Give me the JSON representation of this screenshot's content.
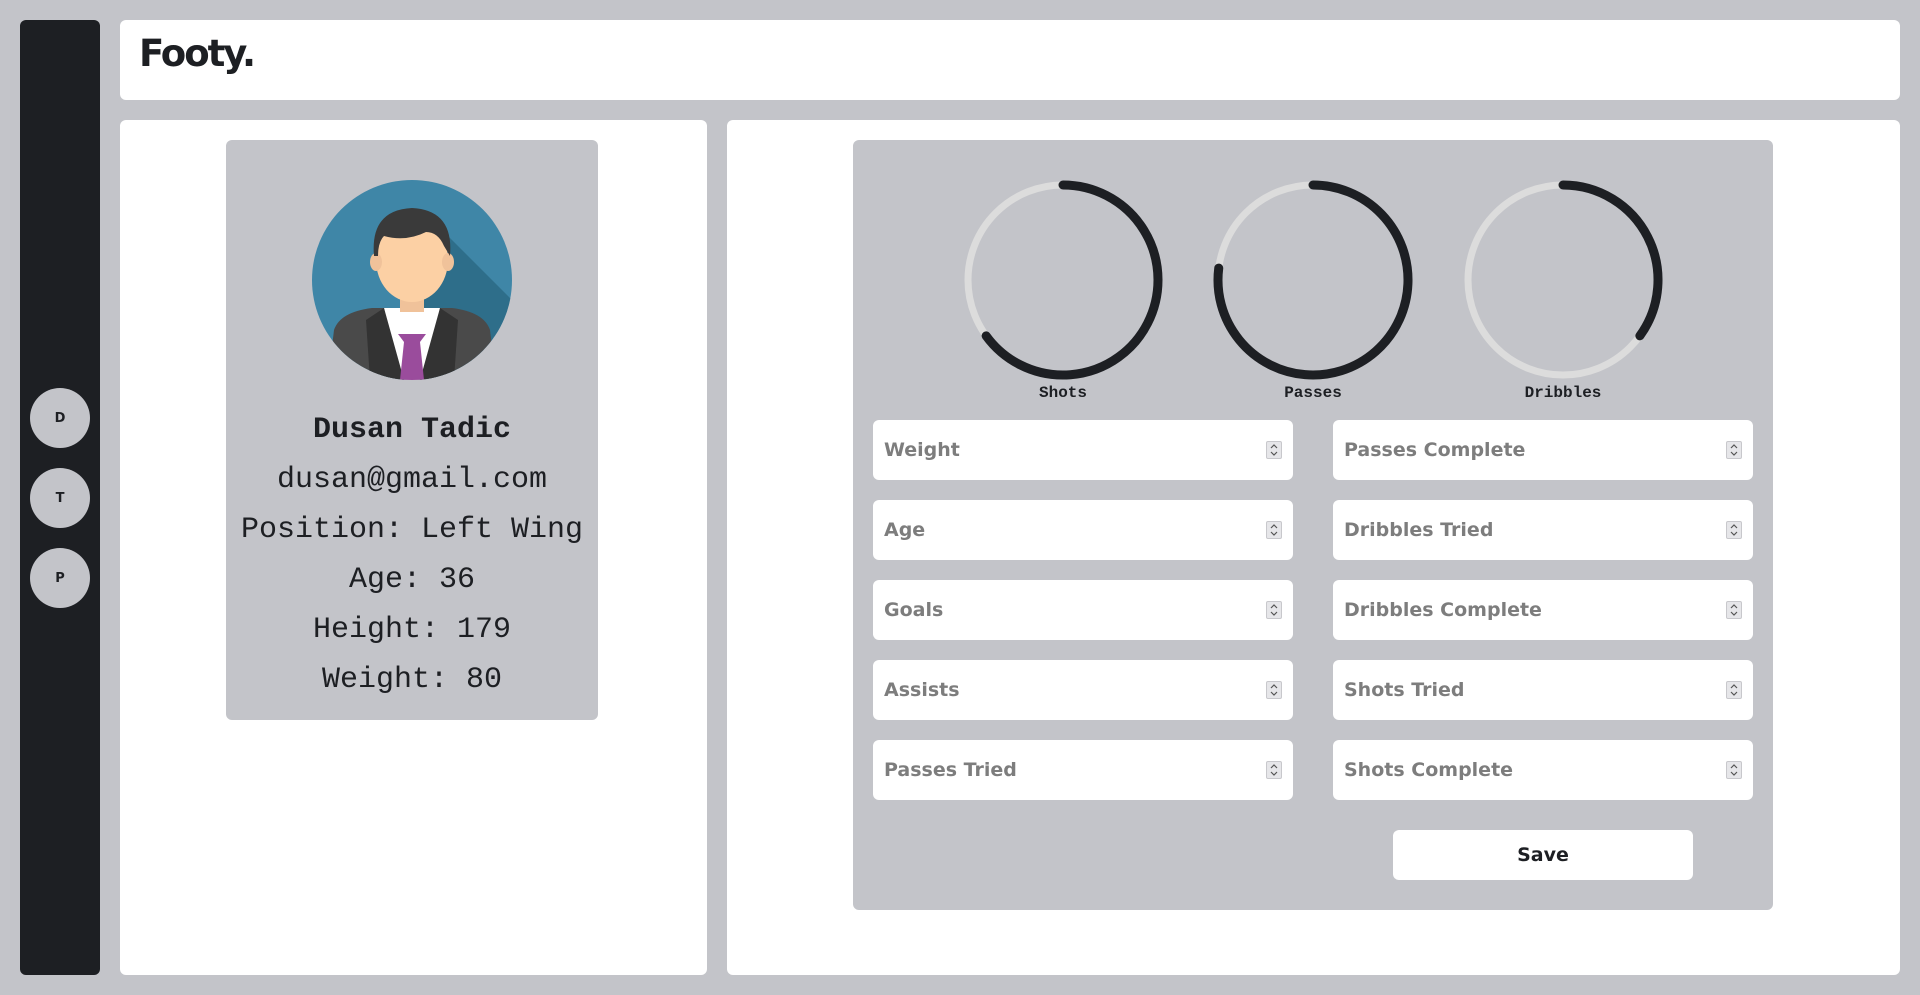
{
  "app": {
    "logo": "Footy."
  },
  "nav": [
    {
      "label": "D"
    },
    {
      "label": "T"
    },
    {
      "label": "P"
    }
  ],
  "profile": {
    "name": "Dusan Tadic",
    "email": "dusan@gmail.com",
    "position": "Position: Left Wing",
    "age": "Age: 36",
    "height": "Height: 179",
    "weight": "Weight: 80"
  },
  "rings": [
    {
      "label": "Shots",
      "value": 0.65,
      "color": "#1d1f23",
      "track": "#dcdcdc"
    },
    {
      "label": "Passes",
      "value": 0.77,
      "color": "#1d1f23",
      "track": "#dcdcdc"
    },
    {
      "label": "Dribbles",
      "value": 0.35,
      "color": "#1d1f23",
      "track": "#dcdcdc"
    }
  ],
  "form": {
    "left": [
      {
        "placeholder": "Weight"
      },
      {
        "placeholder": "Age"
      },
      {
        "placeholder": "Goals"
      },
      {
        "placeholder": "Assists"
      },
      {
        "placeholder": "Passes Tried"
      }
    ],
    "right": [
      {
        "placeholder": "Passes Complete"
      },
      {
        "placeholder": "Dribbles Tried"
      },
      {
        "placeholder": "Dribbles Complete"
      },
      {
        "placeholder": "Shots Tried"
      },
      {
        "placeholder": "Shots Complete"
      }
    ],
    "save_label": "Save"
  },
  "colors": {
    "background": "#c3c4c9",
    "sidebar": "#1d1f23",
    "panel": "#ffffff",
    "avatar_bg": "#3f86a7",
    "tie": "#9a4c9c"
  },
  "icons": {
    "spinner": "updown-spinner-icon"
  }
}
